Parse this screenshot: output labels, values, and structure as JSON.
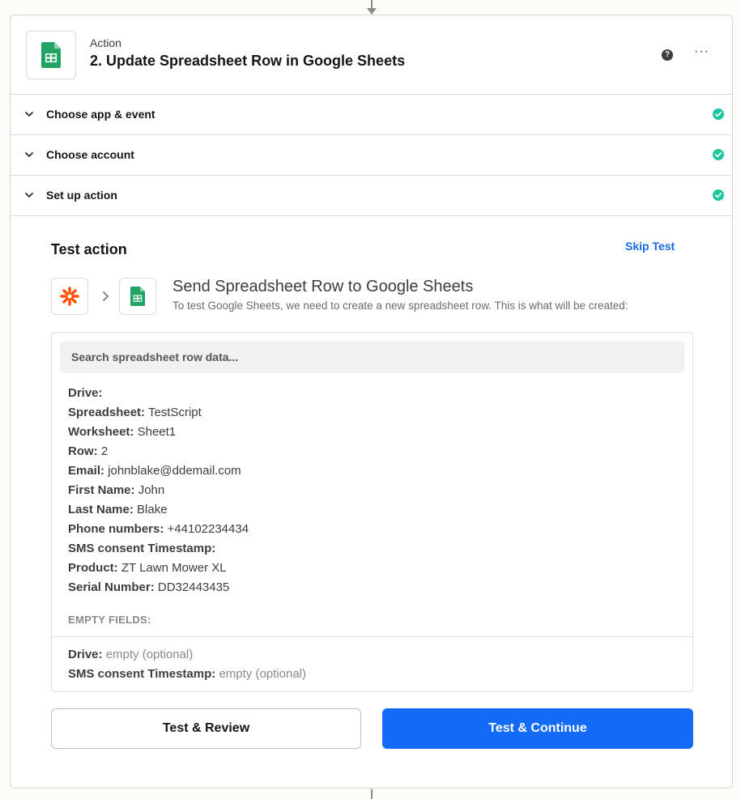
{
  "header": {
    "kind": "Action",
    "title": "2. Update Spreadsheet Row in Google Sheets"
  },
  "steps": [
    {
      "label": "Choose app & event",
      "status": "complete"
    },
    {
      "label": "Choose account",
      "status": "complete"
    },
    {
      "label": "Set up action",
      "status": "complete"
    }
  ],
  "test": {
    "title": "Test action",
    "skip_label": "Skip Test",
    "send_title": "Send Spreadsheet Row to Google Sheets",
    "send_subtitle": "To test Google Sheets, we need to create a new spreadsheet row. This is what will be created:",
    "search_placeholder": "Search spreadsheet row data...",
    "fields": [
      {
        "key": "Drive:",
        "value": ""
      },
      {
        "key": "Spreadsheet:",
        "value": "TestScript"
      },
      {
        "key": "Worksheet:",
        "value": "Sheet1"
      },
      {
        "key": "Row:",
        "value": "2"
      },
      {
        "key": "Email:",
        "value": "johnblake@ddemail.com"
      },
      {
        "key": "First Name:",
        "value": "John"
      },
      {
        "key": "Last Name:",
        "value": "Blake"
      },
      {
        "key": "Phone numbers:",
        "value": "+44102234434"
      },
      {
        "key": "SMS consent Timestamp:",
        "value": ""
      },
      {
        "key": "Product:",
        "value": "ZT Lawn Mower XL"
      },
      {
        "key": "Serial Number:",
        "value": "DD32443435"
      }
    ],
    "empty_heading": "EMPTY FIELDS:",
    "empty_fields": [
      {
        "key": "Drive:",
        "value": "empty (optional)"
      },
      {
        "key": "SMS consent Timestamp:",
        "value": "empty (optional)"
      }
    ],
    "review_label": "Test & Review",
    "continue_label": "Test & Continue"
  },
  "colors": {
    "accent": "#136bf5",
    "link": "#1769e0",
    "check": "#1fc7a0",
    "sheets_green": "#21a464",
    "zapier_orange": "#ff4f00"
  },
  "icons": {
    "app": "google-sheets-icon",
    "trigger": "zapier-asterisk-icon",
    "status": "check-circle-icon",
    "expand": "chevron-down-icon",
    "help": "help-icon",
    "more": "more-icon"
  }
}
